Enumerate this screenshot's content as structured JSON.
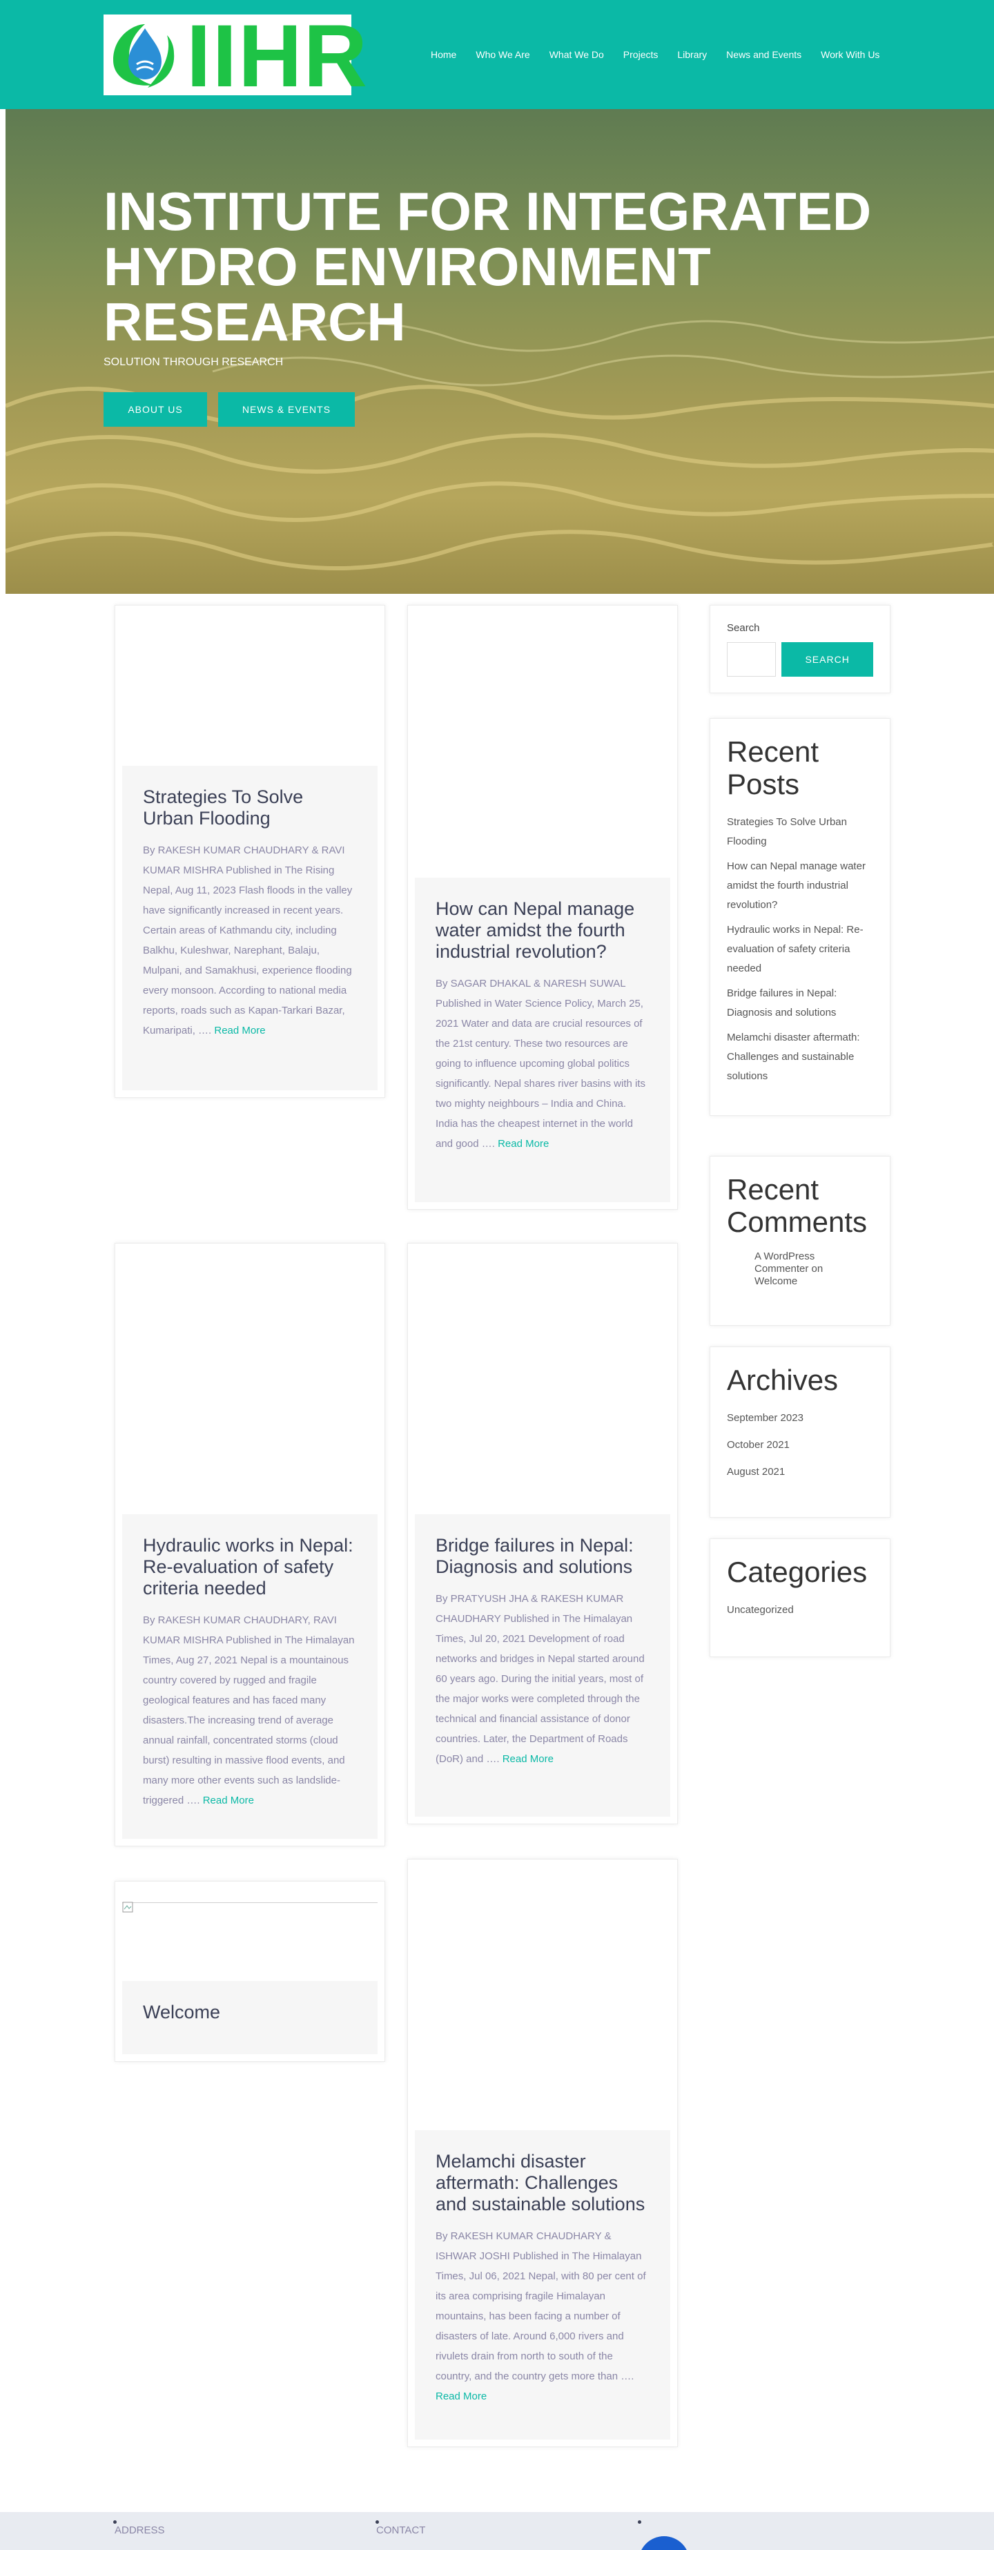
{
  "header": {
    "logo_text": "IIHR",
    "nav": [
      "Home",
      "Who We Are",
      "What We Do",
      "Projects",
      "Library",
      "News and Events",
      "Work With Us"
    ]
  },
  "hero": {
    "title": "INSTITUTE FOR INTEGRATED HYDRO ENVIRONMENT RESEARCH",
    "subtitle": "SOLUTION THROUGH RESEARCH",
    "buttons": [
      "ABOUT US",
      "NEWS & EVENTS"
    ]
  },
  "posts": [
    {
      "title": "Strategies To Solve Urban Flooding",
      "excerpt": "By RAKESH KUMAR CHAUDHARY & RAVI KUMAR MISHRA Published in The Rising Nepal, Aug 11, 2023 Flash floods in the valley have significantly increased in recent years. Certain areas of Kathmandu city, including Balkhu, Kuleshwar, Narephant, Balaju, Mulpani, and Samakhusi, experience flooding every monsoon. According to national media reports, roads such as Kapan-Tarkari Bazar, Kumaripati, …. ",
      "read_more": "Read More"
    },
    {
      "title": "How can Nepal manage water amidst the fourth industrial revolution?",
      "excerpt": "By SAGAR DHAKAL & NARESH SUWAL Published in Water Science Policy, March 25, 2021 Water and data are crucial resources of the 21st century. These two resources are going to influence upcoming global politics significantly. Nepal shares river basins with its two mighty neighbours – India and China. India has the cheapest internet in the world and good …. ",
      "read_more": "Read More"
    },
    {
      "title": "Hydraulic works in Nepal: Re-evaluation of safety criteria needed",
      "excerpt": "By RAKESH KUMAR CHAUDHARY, RAVI KUMAR MISHRA Published in The Himalayan Times, Aug 27, 2021 Nepal is a mountainous country covered by rugged and fragile geological features and has faced many disasters.The increasing trend of average annual rainfall, concentrated storms (cloud burst) resulting in massive flood events, and many more other events such as landslide-triggered …. ",
      "read_more": "Read More"
    },
    {
      "title": "Bridge failures in Nepal: Diagnosis and solutions",
      "excerpt": "By PRATYUSH JHA & RAKESH KUMAR CHAUDHARY Published in The Himalayan Times, Jul 20, 2021 Development of road networks and bridges in Nepal started around 60 years ago. During the initial years, most of the major works were completed through the technical and financial assistance of donor countries. Later, the Department of Roads (DoR) and …. ",
      "read_more": "Read More"
    },
    {
      "title": "Welcome",
      "excerpt": "",
      "read_more": ""
    },
    {
      "title": "Melamchi disaster aftermath: Challenges and sustainable solutions",
      "excerpt": "By RAKESH KUMAR CHAUDHARY & ISHWAR JOSHI Published in The Himalayan Times, Jul 06, 2021 Nepal, with 80 per cent of its area comprising fragile Himalayan mountains, has been facing a number of disasters of late. Around 6,000 rivers and rivulets drain from north to south of the country, and the country gets more than …. ",
      "read_more": "Read More"
    }
  ],
  "sidebar": {
    "search_label": "Search",
    "search_button": "SEARCH",
    "recent_posts_title": "Recent Posts",
    "recent_posts": [
      "Strategies To Solve Urban Flooding",
      "How can Nepal manage water amidst the fourth industrial revolution?",
      "Hydraulic works in Nepal: Re-evaluation of safety criteria needed",
      "Bridge failures in Nepal: Diagnosis and solutions",
      "Melamchi disaster aftermath: Challenges and sustainable solutions"
    ],
    "recent_comments_title": "Recent Comments",
    "comment": "A WordPress Commenter on Welcome",
    "archives_title": "Archives",
    "archives": [
      "September 2023",
      "October 2021",
      "August 2021"
    ],
    "categories_title": "Categories",
    "categories": [
      "Uncategorized"
    ]
  },
  "footer": {
    "columns": [
      "ADDRESS",
      "CONTACT"
    ]
  },
  "colors": {
    "accent": "#0bb9a6",
    "logo_green": "#1ec346"
  }
}
